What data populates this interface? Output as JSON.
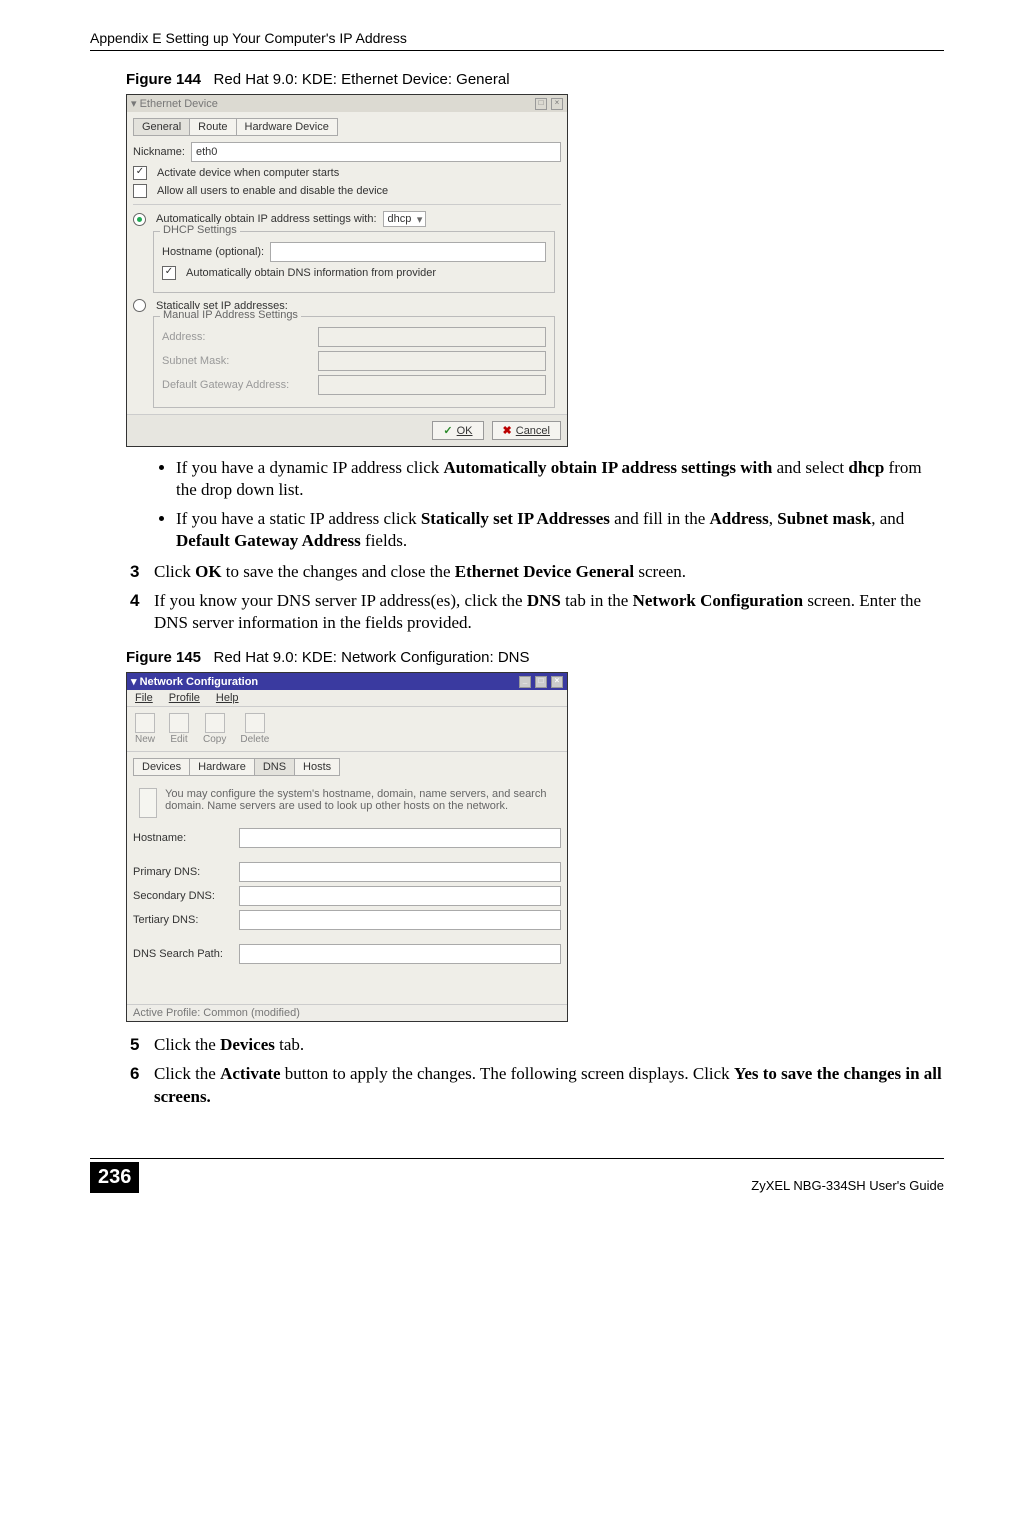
{
  "header": {
    "appendix_title": "Appendix E Setting up Your Computer's IP Address"
  },
  "figure144": {
    "label": "Figure 144",
    "caption": "Red Hat 9.0: KDE: Ethernet Device: General",
    "window_title": "Ethernet Device",
    "tabs": {
      "general": "General",
      "route": "Route",
      "hardware": "Hardware Device"
    },
    "nickname_label": "Nickname:",
    "nickname_value": "eth0",
    "activate_label": "Activate device when computer starts",
    "allow_users_label": "Allow all users to enable and disable the device",
    "auto_ip_label": "Automatically obtain IP address settings with:",
    "auto_ip_value": "dhcp",
    "dhcp_group": "DHCP Settings",
    "hostname_label": "Hostname (optional):",
    "auto_dns_label": "Automatically obtain DNS information from provider",
    "static_label": "Statically set IP addresses:",
    "manual_group": "Manual IP Address Settings",
    "address_label": "Address:",
    "subnet_label": "Subnet Mask:",
    "gateway_label": "Default Gateway Address:",
    "ok": "OK",
    "cancel": "Cancel"
  },
  "bullets": {
    "b1_pre": "If you have a dynamic IP address click ",
    "b1_bold1": "Automatically obtain IP address settings with",
    "b1_mid": " and select ",
    "b1_bold2": "dhcp",
    "b1_post": " from the drop down list.",
    "b2_pre": "If you have a static IP address click ",
    "b2_bold1": "Statically set IP Addresses",
    "b2_mid1": " and fill in the ",
    "b2_bold2": "Address",
    "b2_c1": ", ",
    "b2_bold3": "Subnet mask",
    "b2_c2": ", and ",
    "b2_bold4": "Default Gateway Address",
    "b2_post": " fields."
  },
  "steps1": {
    "n3": "3",
    "s3_pre": "Click ",
    "s3_b1": "OK",
    "s3_mid": " to save the changes and close the ",
    "s3_b2": "Ethernet Device General",
    "s3_post": " screen.",
    "n4": "4",
    "s4_pre": "If you know your DNS server IP address(es), click the ",
    "s4_b1": "DNS",
    "s4_mid": " tab in the ",
    "s4_b2": "Network Configuration",
    "s4_post": " screen. Enter the DNS server information in the fields provided."
  },
  "figure145": {
    "label": "Figure 145",
    "caption": "Red Hat 9.0: KDE: Network Configuration: DNS",
    "window_title": "Network Configuration",
    "menu": {
      "file": "File",
      "profile": "Profile",
      "help": "Help"
    },
    "toolbar": {
      "new": "New",
      "edit": "Edit",
      "copy": "Copy",
      "delete": "Delete"
    },
    "tabs": {
      "devices": "Devices",
      "hardware": "Hardware",
      "dns": "DNS",
      "hosts": "Hosts"
    },
    "info": "You may configure the system's hostname, domain, name servers, and search domain. Name servers are used to look up other hosts on the network.",
    "hostname": "Hostname:",
    "primary": "Primary DNS:",
    "secondary": "Secondary DNS:",
    "tertiary": "Tertiary DNS:",
    "search": "DNS Search Path:",
    "status": "Active Profile: Common (modified)"
  },
  "steps2": {
    "n5": "5",
    "s5_pre": "Click the ",
    "s5_b1": "Devices",
    "s5_post": " tab.",
    "n6": "6",
    "s6_pre": "Click the ",
    "s6_b1": "Activate",
    "s6_mid": " button to apply the changes. The following screen displays. Click ",
    "s6_b2": "Yes",
    "s6_post": " to save the changes in all screens."
  },
  "footer": {
    "page": "236",
    "guide": "ZyXEL NBG-334SH User's Guide"
  }
}
